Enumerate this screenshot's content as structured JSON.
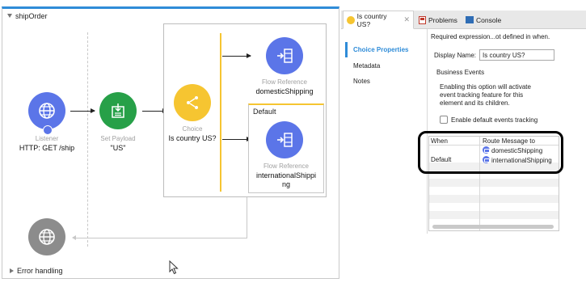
{
  "flow": {
    "name": "shipOrder",
    "error_handling": "Error handling"
  },
  "listener": {
    "type": "Listener",
    "label": "HTTP: GET /ship"
  },
  "set_payload": {
    "type": "Set Payload",
    "label": "\"US\""
  },
  "choice": {
    "type": "Choice",
    "label": "Is country US?"
  },
  "flow_ref_1": {
    "type": "Flow Reference",
    "label": "domesticShipping"
  },
  "default_route": {
    "label": "Default"
  },
  "flow_ref_2": {
    "type": "Flow Reference",
    "label_line1": "internationalShippi",
    "label_line2": "ng"
  },
  "tabs": {
    "t1": "Is country US?",
    "t2": "Problems",
    "t3": "Console"
  },
  "nav": {
    "choice_properties": "Choice Properties",
    "metadata": "Metadata",
    "notes": "Notes"
  },
  "props": {
    "required_text": "Required expression...ot defined in when.",
    "display_name_label": "Display Name:",
    "display_name_value": "Is country US?",
    "business_events": "Business Events",
    "be_desc_1": "Enabling this option will activate",
    "be_desc_2": "event tracking feature for this",
    "be_desc_3": "element and its children.",
    "enable_tracking": "Enable default events tracking"
  },
  "table": {
    "col_when": "When",
    "col_route": "Route Message to",
    "rows": [
      {
        "when": "",
        "route": "domesticShipping"
      },
      {
        "when": "Default",
        "route": "internationalShipping"
      }
    ]
  },
  "colors": {
    "accent_blue": "#2f8cd8",
    "flow_ref_purple": "#5b75e8",
    "choice_yellow": "#f6c531",
    "set_payload_green": "#27a048"
  }
}
